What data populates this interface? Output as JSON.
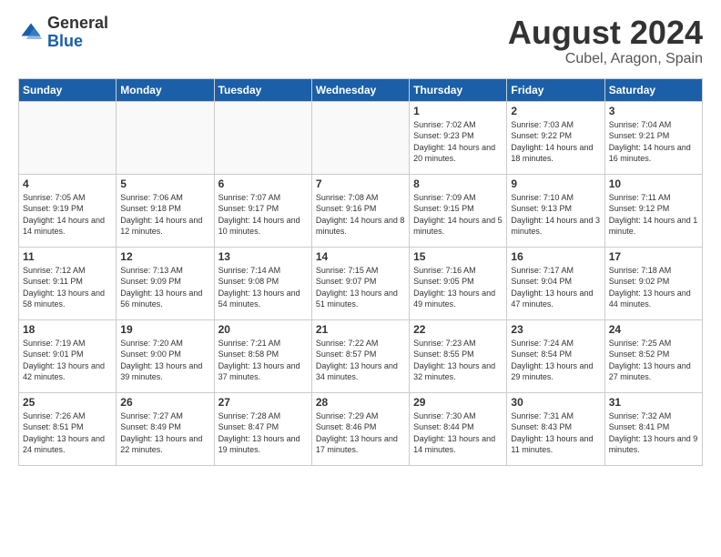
{
  "header": {
    "logo_general": "General",
    "logo_blue": "Blue",
    "main_title": "August 2024",
    "subtitle": "Cubel, Aragon, Spain"
  },
  "calendar": {
    "days_of_week": [
      "Sunday",
      "Monday",
      "Tuesday",
      "Wednesday",
      "Thursday",
      "Friday",
      "Saturday"
    ],
    "weeks": [
      [
        {
          "day": "",
          "info": ""
        },
        {
          "day": "",
          "info": ""
        },
        {
          "day": "",
          "info": ""
        },
        {
          "day": "",
          "info": ""
        },
        {
          "day": "1",
          "info": "Sunrise: 7:02 AM\nSunset: 9:23 PM\nDaylight: 14 hours\nand 20 minutes."
        },
        {
          "day": "2",
          "info": "Sunrise: 7:03 AM\nSunset: 9:22 PM\nDaylight: 14 hours\nand 18 minutes."
        },
        {
          "day": "3",
          "info": "Sunrise: 7:04 AM\nSunset: 9:21 PM\nDaylight: 14 hours\nand 16 minutes."
        }
      ],
      [
        {
          "day": "4",
          "info": "Sunrise: 7:05 AM\nSunset: 9:19 PM\nDaylight: 14 hours\nand 14 minutes."
        },
        {
          "day": "5",
          "info": "Sunrise: 7:06 AM\nSunset: 9:18 PM\nDaylight: 14 hours\nand 12 minutes."
        },
        {
          "day": "6",
          "info": "Sunrise: 7:07 AM\nSunset: 9:17 PM\nDaylight: 14 hours\nand 10 minutes."
        },
        {
          "day": "7",
          "info": "Sunrise: 7:08 AM\nSunset: 9:16 PM\nDaylight: 14 hours\nand 8 minutes."
        },
        {
          "day": "8",
          "info": "Sunrise: 7:09 AM\nSunset: 9:15 PM\nDaylight: 14 hours\nand 5 minutes."
        },
        {
          "day": "9",
          "info": "Sunrise: 7:10 AM\nSunset: 9:13 PM\nDaylight: 14 hours\nand 3 minutes."
        },
        {
          "day": "10",
          "info": "Sunrise: 7:11 AM\nSunset: 9:12 PM\nDaylight: 14 hours\nand 1 minute."
        }
      ],
      [
        {
          "day": "11",
          "info": "Sunrise: 7:12 AM\nSunset: 9:11 PM\nDaylight: 13 hours\nand 58 minutes."
        },
        {
          "day": "12",
          "info": "Sunrise: 7:13 AM\nSunset: 9:09 PM\nDaylight: 13 hours\nand 56 minutes."
        },
        {
          "day": "13",
          "info": "Sunrise: 7:14 AM\nSunset: 9:08 PM\nDaylight: 13 hours\nand 54 minutes."
        },
        {
          "day": "14",
          "info": "Sunrise: 7:15 AM\nSunset: 9:07 PM\nDaylight: 13 hours\nand 51 minutes."
        },
        {
          "day": "15",
          "info": "Sunrise: 7:16 AM\nSunset: 9:05 PM\nDaylight: 13 hours\nand 49 minutes."
        },
        {
          "day": "16",
          "info": "Sunrise: 7:17 AM\nSunset: 9:04 PM\nDaylight: 13 hours\nand 47 minutes."
        },
        {
          "day": "17",
          "info": "Sunrise: 7:18 AM\nSunset: 9:02 PM\nDaylight: 13 hours\nand 44 minutes."
        }
      ],
      [
        {
          "day": "18",
          "info": "Sunrise: 7:19 AM\nSunset: 9:01 PM\nDaylight: 13 hours\nand 42 minutes."
        },
        {
          "day": "19",
          "info": "Sunrise: 7:20 AM\nSunset: 9:00 PM\nDaylight: 13 hours\nand 39 minutes."
        },
        {
          "day": "20",
          "info": "Sunrise: 7:21 AM\nSunset: 8:58 PM\nDaylight: 13 hours\nand 37 minutes."
        },
        {
          "day": "21",
          "info": "Sunrise: 7:22 AM\nSunset: 8:57 PM\nDaylight: 13 hours\nand 34 minutes."
        },
        {
          "day": "22",
          "info": "Sunrise: 7:23 AM\nSunset: 8:55 PM\nDaylight: 13 hours\nand 32 minutes."
        },
        {
          "day": "23",
          "info": "Sunrise: 7:24 AM\nSunset: 8:54 PM\nDaylight: 13 hours\nand 29 minutes."
        },
        {
          "day": "24",
          "info": "Sunrise: 7:25 AM\nSunset: 8:52 PM\nDaylight: 13 hours\nand 27 minutes."
        }
      ],
      [
        {
          "day": "25",
          "info": "Sunrise: 7:26 AM\nSunset: 8:51 PM\nDaylight: 13 hours\nand 24 minutes."
        },
        {
          "day": "26",
          "info": "Sunrise: 7:27 AM\nSunset: 8:49 PM\nDaylight: 13 hours\nand 22 minutes."
        },
        {
          "day": "27",
          "info": "Sunrise: 7:28 AM\nSunset: 8:47 PM\nDaylight: 13 hours\nand 19 minutes."
        },
        {
          "day": "28",
          "info": "Sunrise: 7:29 AM\nSunset: 8:46 PM\nDaylight: 13 hours\nand 17 minutes."
        },
        {
          "day": "29",
          "info": "Sunrise: 7:30 AM\nSunset: 8:44 PM\nDaylight: 13 hours\nand 14 minutes."
        },
        {
          "day": "30",
          "info": "Sunrise: 7:31 AM\nSunset: 8:43 PM\nDaylight: 13 hours\nand 11 minutes."
        },
        {
          "day": "31",
          "info": "Sunrise: 7:32 AM\nSunset: 8:41 PM\nDaylight: 13 hours\nand 9 minutes."
        }
      ]
    ]
  }
}
